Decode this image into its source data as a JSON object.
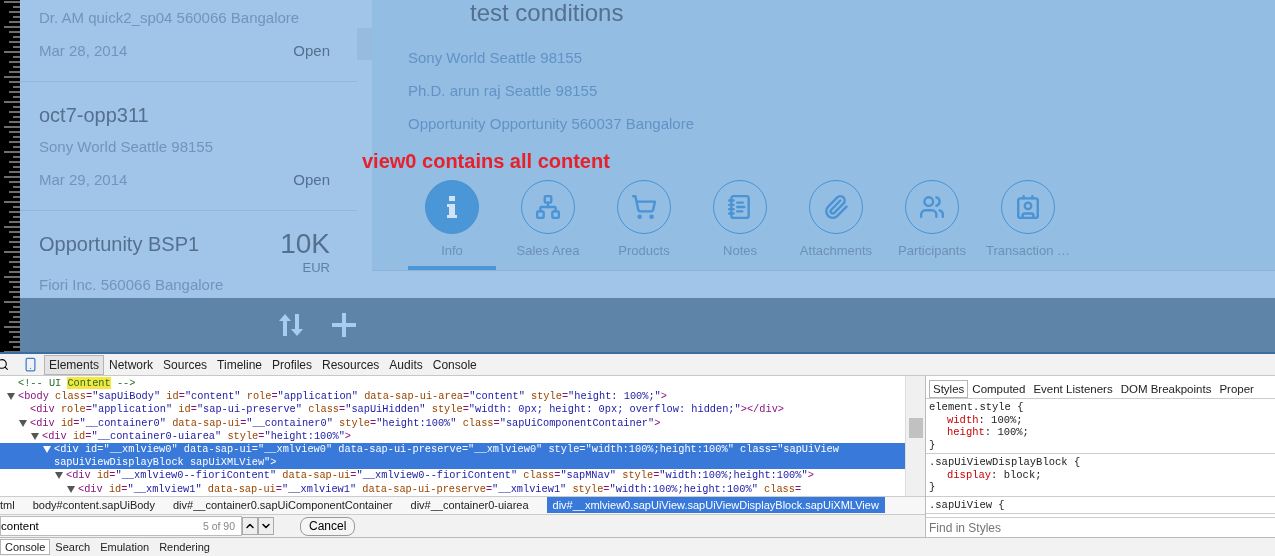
{
  "master_list": {
    "items": [
      {
        "subtitle": "Dr. AM quick2_sp04 560066 Bangalore",
        "date": "Mar 28, 2014",
        "status": "Open"
      },
      {
        "title": "oct7-opp311",
        "subtitle": "Sony World Seattle 98155",
        "date": "Mar 29, 2014",
        "status": "Open"
      },
      {
        "title": "Opportunity BSP1",
        "number": "10K",
        "unit": "EUR",
        "subtitle": "Fiori Inc. 560066 Bangalore"
      }
    ]
  },
  "detail": {
    "title": "test conditions",
    "lines": [
      "Sony World Seattle 98155",
      "Ph.D. arun raj Seattle 98155",
      "Opportunity Opportunity 560037 Bangalore"
    ],
    "tabs": [
      {
        "kind": "info",
        "label": "Info",
        "selected": true
      },
      {
        "kind": "hierarchy",
        "label": "Sales Area",
        "selected": false
      },
      {
        "kind": "cart",
        "label": "Products",
        "selected": false
      },
      {
        "kind": "notes",
        "label": "Notes",
        "selected": false
      },
      {
        "kind": "attachment",
        "label": "Attachments",
        "selected": false
      },
      {
        "kind": "people",
        "label": "Participants",
        "selected": false
      },
      {
        "kind": "card",
        "label": "Transaction …",
        "selected": false
      }
    ]
  },
  "annotation": "view0 contains all content",
  "devtools": {
    "tabs": [
      {
        "label": "Elements",
        "selected": true
      },
      {
        "label": "Network",
        "selected": false
      },
      {
        "label": "Sources",
        "selected": false
      },
      {
        "label": "Timeline",
        "selected": false
      },
      {
        "label": "Profiles",
        "selected": false
      },
      {
        "label": "Resources",
        "selected": false
      },
      {
        "label": "Audits",
        "selected": false
      },
      {
        "label": "Console",
        "selected": false
      }
    ],
    "dom_tree": [
      {
        "kind": "comment",
        "text": "<!-- UI ",
        "highlight": "Content",
        "text_after": " -->"
      },
      {
        "kind": "element",
        "text": "<body class=\"sapUiBody\" id=\"content\" role=\"application\" data-sap-ui-area=\"content\" style=\"height: 100%;\">",
        "expanded": true,
        "selected": false,
        "children": [
          {
            "kind": "leaf",
            "text": "<div role=\"application\" id=\"sap-ui-preserve\" class=\"sapUiHidden\" style=\"width: 0px; height: 0px; overflow: hidden;\"></div>",
            "selected": false
          },
          {
            "kind": "element",
            "text": "<div id=\"__container0\" data-sap-ui=\"__container0\" style=\"height:100%\" class=\"sapUiComponentContainer\">",
            "expanded": true,
            "selected": false,
            "children": [
              {
                "kind": "element",
                "text": "<div id=\"__container0-uiarea\" style=\"height:100%\">",
                "expanded": true,
                "selected": false,
                "children": [
                  {
                    "kind": "element",
                    "text": "<div id=\"__xmlview0\" data-sap-ui=\"__xmlview0\" data-sap-ui-preserve=\"__xmlview0\" style=\"width:100%;height:100%\" class=\"sapUiView sapUiViewDisplayBlock sapUiXMLView\">",
                    "expanded": true,
                    "selected": true,
                    "children": [
                      {
                        "kind": "element",
                        "text": "<div id=\"__xmlview0--fioriContent\" data-sap-ui=\"__xmlview0--fioriContent\" class=\"sapMNav\" style=\"width:100%;height:100%\">",
                        "expanded": true,
                        "selected": false,
                        "children": [
                          {
                            "kind": "element",
                            "text": "<div id=\"__xmlview1\" data-sap-ui=\"__xmlview1\" data-sap-ui-preserve=\"__xmlview1\" style=\"width:100%;height:100%\" class=",
                            "expanded": true,
                            "selected": false
                          }
                        ]
                      }
                    ]
                  }
                ]
              }
            ]
          }
        ]
      }
    ],
    "breadcrumbs": [
      {
        "label": "tml",
        "selected": false
      },
      {
        "label": "body#content.sapUiBody",
        "selected": false
      },
      {
        "label": "div#__container0.sapUiComponentContainer",
        "selected": false
      },
      {
        "label": "div#__container0-uiarea",
        "selected": false
      },
      {
        "label": "div#__xmlview0.sapUiView.sapUiViewDisplayBlock.sapUiXMLView",
        "selected": true
      }
    ],
    "search": {
      "value": "content",
      "count": "5 of 90",
      "cancel": "Cancel"
    },
    "styles_tabs": [
      {
        "label": "Styles",
        "selected": true
      },
      {
        "label": "Computed",
        "selected": false
      },
      {
        "label": "Event Listeners",
        "selected": false
      },
      {
        "label": "DOM Breakpoints",
        "selected": false
      },
      {
        "label": "Proper",
        "selected": false
      }
    ],
    "style_rules": [
      {
        "selector": "element.style {",
        "properties": [
          {
            "name": "width",
            "value": ": 100%;"
          },
          {
            "name": "height",
            "value": ": 100%;"
          }
        ],
        "close": "}"
      },
      {
        "selector": ".sapUiViewDisplayBlock {",
        "properties": [
          {
            "name": "display",
            "value": ": block;"
          }
        ],
        "close": "}"
      },
      {
        "selector": ".sapUiView {"
      }
    ],
    "styles_filter": {
      "placeholder": "Find in Styles"
    },
    "drawer_tabs": [
      {
        "label": "Console",
        "selected": true
      },
      {
        "label": "Search",
        "selected": false
      },
      {
        "label": "Emulation",
        "selected": false
      },
      {
        "label": "Rendering",
        "selected": false
      }
    ]
  }
}
